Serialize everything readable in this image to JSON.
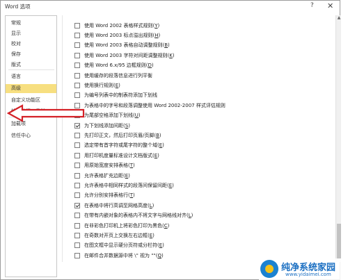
{
  "window": {
    "title": "Word 选项",
    "help_glyph": "?",
    "close_glyph": "✕"
  },
  "sidebar": {
    "items": [
      {
        "label": "常规",
        "selected": false
      },
      {
        "label": "显示",
        "selected": false
      },
      {
        "label": "校对",
        "selected": false
      },
      {
        "label": "保存",
        "selected": false
      },
      {
        "label": "版式",
        "selected": false
      },
      {
        "label": "语言",
        "selected": false
      },
      {
        "label": "高级",
        "selected": true
      },
      {
        "label": "自定义功能区",
        "selected": false
      },
      {
        "label": "快速访问工具栏",
        "selected": false
      },
      {
        "label": "加载项",
        "selected": false
      },
      {
        "label": "信任中心",
        "selected": false
      }
    ]
  },
  "options": [
    {
      "label": "使用 Word 2002 表格样式规则",
      "key": "Y",
      "checked": false
    },
    {
      "label": "使用 Word 2003 标点溢出规则",
      "key": "H",
      "checked": false
    },
    {
      "label": "使用 Word 2003 表格自动调整规则",
      "key": "B",
      "checked": false
    },
    {
      "label": "使用 Word 2003 字符对间距调整规则",
      "key": "K",
      "checked": false
    },
    {
      "label": "使用 Word 6.x/95 边框规则",
      "key": "D",
      "checked": false
    },
    {
      "label": "使用缓存的段落信息进行列平衡",
      "key": "",
      "checked": false
    },
    {
      "label": "使用换行规则",
      "key": "E",
      "checked": false
    },
    {
      "label": "为编号列表中的制表符添加下划线",
      "key": "",
      "checked": false
    },
    {
      "label": "为表格中的字号和段落调整使用 Word 2002-2007 样式评估规则",
      "key": "",
      "checked": false
    },
    {
      "label": "为尾部空格添加下划线",
      "key": "U",
      "checked": true
    },
    {
      "label": "为下划线添加间距",
      "key": "S",
      "checked": true
    },
    {
      "label": "先打印正文，然后打印页眉/页脚",
      "key": "B",
      "checked": false
    },
    {
      "label": "选定带有首字符或尾字符的整个域",
      "key": "E",
      "checked": false
    },
    {
      "label": "用打印机度量标准设计文档版式",
      "key": "E",
      "checked": false
    },
    {
      "label": "用原始宽度安排表格",
      "key": "T",
      "checked": false
    },
    {
      "label": "允许表格扩充边距",
      "key": "E",
      "checked": false
    },
    {
      "label": "允许表格中相同样式的段落间保留间距",
      "key": "E",
      "checked": false
    },
    {
      "label": "允许分别安排表格行",
      "key": "T",
      "checked": false
    },
    {
      "label": "在表格中将行高调至网格高度",
      "key": "L",
      "checked": true
    },
    {
      "label": "在带有内嵌对象的表格内不将文字与网格线对齐",
      "key": "L",
      "checked": false
    },
    {
      "label": "在非彩色打印机上将彩色打印为黑色",
      "key": "C",
      "checked": false
    },
    {
      "label": "在奇数对开页上交换左右边框",
      "key": "E",
      "checked": false
    },
    {
      "label": "在图文框中显示硬分页符或分栏符",
      "key": "E",
      "checked": false
    },
    {
      "label": "在邮件合并数据源中将 \\\" 视为 \"\"",
      "key": "Q",
      "checked": false
    }
  ],
  "watermark": {
    "title": "纯净系统家园",
    "url": "www.yidaimei.com"
  },
  "colors": {
    "selected_nav": "#f7df80",
    "arrow": "#d42026",
    "brand_blue": "#1b82d1"
  },
  "icons": {
    "arrow": "red-arrow-annotation",
    "scroll_up": "scroll-up-arrow-icon"
  }
}
